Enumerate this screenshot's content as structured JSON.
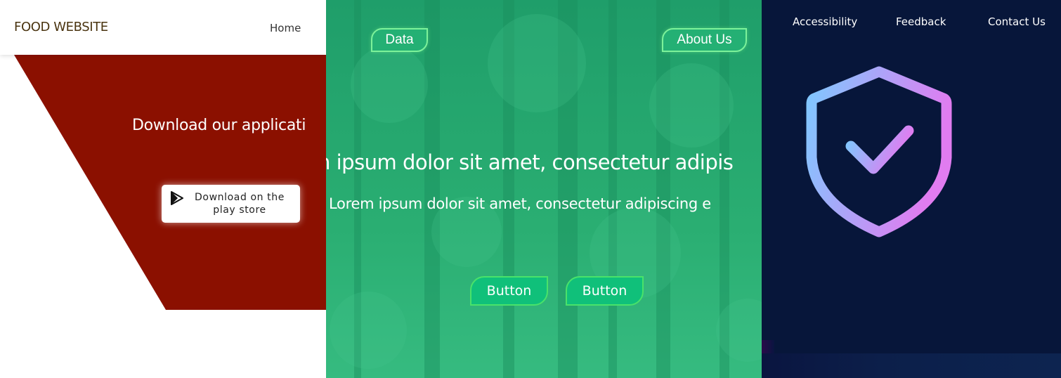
{
  "food_panel": {
    "brand": "FOOD WEBSITE",
    "nav_home": "Home",
    "download_title": "Download our applicati",
    "store_button": {
      "line1": "Download on the",
      "line2": "play store",
      "icon": "play-store-icon"
    },
    "colors": {
      "banner": "#8b1000",
      "brand_text": "#4a3410"
    }
  },
  "green_panel": {
    "nav_buttons": [
      "Data",
      "About Us"
    ],
    "hero_line1": "n ipsum dolor sit amet, consectetur adipis",
    "hero_line2": "Lorem ipsum dolor sit amet, consectetur adipiscing e",
    "cta_buttons": [
      "Button",
      "Button"
    ],
    "colors": {
      "background": "#27a872",
      "button_border": "#49e26a",
      "button_fill": "#10c07a"
    }
  },
  "dark_panel": {
    "links": [
      "Accessibility",
      "Feedback",
      "Contact Us"
    ],
    "icon": "shield-check-icon",
    "colors": {
      "background": "#07163a",
      "gradient_start": "#7fc8ff",
      "gradient_end": "#e07cf0"
    }
  }
}
